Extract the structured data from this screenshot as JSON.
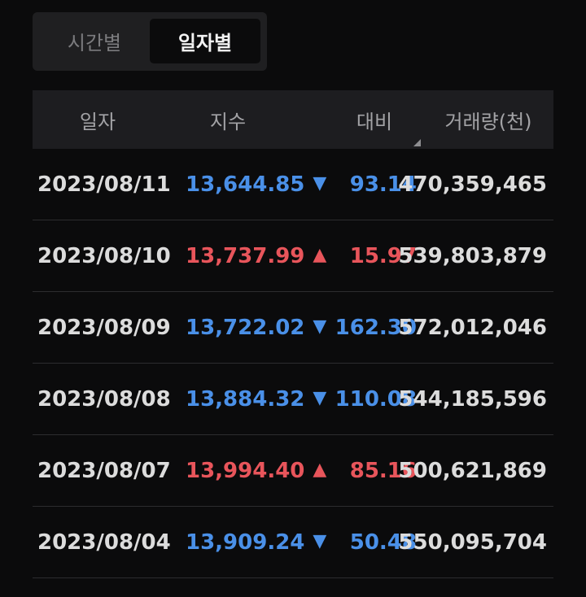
{
  "toggle": {
    "options": [
      {
        "label": "시간별",
        "selected": false
      },
      {
        "label": "일자별",
        "selected": true
      }
    ]
  },
  "table": {
    "headers": {
      "date": "일자",
      "index": "지수",
      "change": "대비",
      "volume": "거래량(천)"
    },
    "rows": [
      {
        "date": "2023/08/11",
        "index": "13,644.85",
        "direction": "down",
        "arrow": "▼",
        "change": "93.14",
        "volume": "470,359,465"
      },
      {
        "date": "2023/08/10",
        "index": "13,737.99",
        "direction": "up",
        "arrow": "▲",
        "change": "15.97",
        "volume": "539,803,879"
      },
      {
        "date": "2023/08/09",
        "index": "13,722.02",
        "direction": "down",
        "arrow": "▼",
        "change": "162.30",
        "volume": "572,012,046"
      },
      {
        "date": "2023/08/08",
        "index": "13,884.32",
        "direction": "down",
        "arrow": "▼",
        "change": "110.08",
        "volume": "544,185,596"
      },
      {
        "date": "2023/08/07",
        "index": "13,994.40",
        "direction": "up",
        "arrow": "▲",
        "change": "85.16",
        "volume": "500,621,869"
      },
      {
        "date": "2023/08/04",
        "index": "13,909.24",
        "direction": "down",
        "arrow": "▼",
        "change": "50.48",
        "volume": "550,095,704"
      }
    ]
  },
  "colors": {
    "up": "#e8555b",
    "down": "#4a90e8"
  }
}
